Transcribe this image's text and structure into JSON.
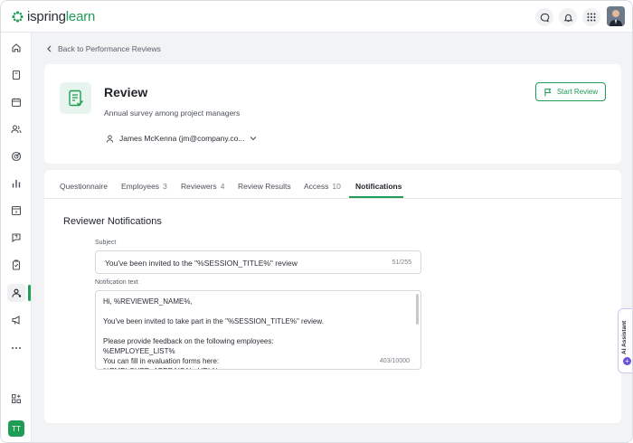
{
  "app": {
    "brand_main": "ispring",
    "brand_accent": "learn",
    "accent_color": "#1f9d55"
  },
  "topbar": {
    "icons": [
      "chat-icon",
      "bell-icon",
      "apps-grid-icon"
    ],
    "avatar": "user-avatar"
  },
  "sidebar": {
    "items": [
      "home-icon",
      "book-icon",
      "calendar-icon",
      "users-icon",
      "target-icon",
      "bar-chart-icon",
      "id-card-icon",
      "help-chat-icon",
      "clipboard-check-icon",
      "review-icon",
      "megaphone-icon",
      "more-icon",
      "add-widget-icon"
    ],
    "active": "review-icon",
    "user_initials": "TT"
  },
  "breadcrumb": {
    "back_label": "Back to Performance Reviews"
  },
  "review": {
    "title": "Review",
    "subtitle": "Annual survey among project managers",
    "owner": "James McKenna (jm@company.co...",
    "start_button": "Start Review"
  },
  "tabs": [
    {
      "label": "Questionnaire",
      "count": ""
    },
    {
      "label": "Employees",
      "count": "3"
    },
    {
      "label": "Reviewers",
      "count": "4"
    },
    {
      "label": "Review Results",
      "count": ""
    },
    {
      "label": "Access",
      "count": "10"
    },
    {
      "label": "Notifications",
      "count": ""
    }
  ],
  "notifications": {
    "section_title": "Reviewer Notifications",
    "subject_label": "Subject",
    "subject_value": "You've been invited to the \"%SESSION_TITLE%\" review",
    "subject_counter": "51/255",
    "text_label": "Notification text",
    "text_value": "Hi, %REVIEWER_NAME%,\n\nYou've been invited to take part in the \"%SESSION_TITLE%\" review.\n\nPlease provide feedback on the following employees:\n%EMPLOYEE_LIST%\nYou can fill in evaluation forms here:\n%EMPLOYEE_APPRAISAL_URL%",
    "text_counter": "403/10000"
  },
  "ai_assistant": {
    "label": "AI Assistant"
  }
}
